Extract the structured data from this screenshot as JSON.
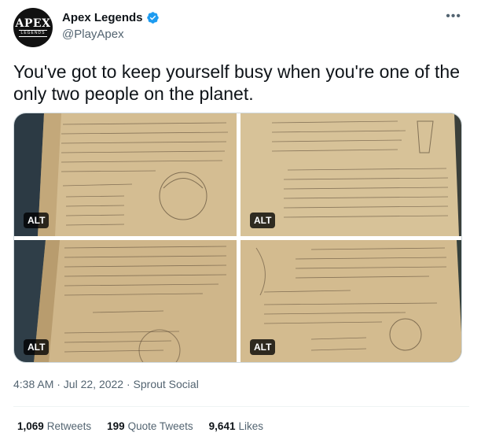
{
  "account": {
    "display_name": "Apex Legends",
    "handle": "@PlayApex",
    "avatar_text": "APEX",
    "avatar_subtext": "LEGENDS"
  },
  "tweet": {
    "text": "You've got to keep yourself busy when you're one of the only two people on the planet.",
    "timestamp": "4:38 AM · Jul 22, 2022 · Sprout Social"
  },
  "media": {
    "alt_label": "ALT",
    "photos": [
      {
        "id": "photo-1"
      },
      {
        "id": "photo-2"
      },
      {
        "id": "photo-3"
      },
      {
        "id": "photo-4"
      }
    ]
  },
  "stats": {
    "retweets_count": "1,069",
    "retweets_label": "Retweets",
    "quotes_count": "199",
    "quotes_label": "Quote Tweets",
    "likes_count": "9,641",
    "likes_label": "Likes"
  },
  "colors": {
    "paper": "#d9c39a",
    "paper_dark": "#8a6d44",
    "background_dark": "#2c3a44",
    "ink": "#4a3a2a",
    "verified": "#1d9bf0"
  }
}
